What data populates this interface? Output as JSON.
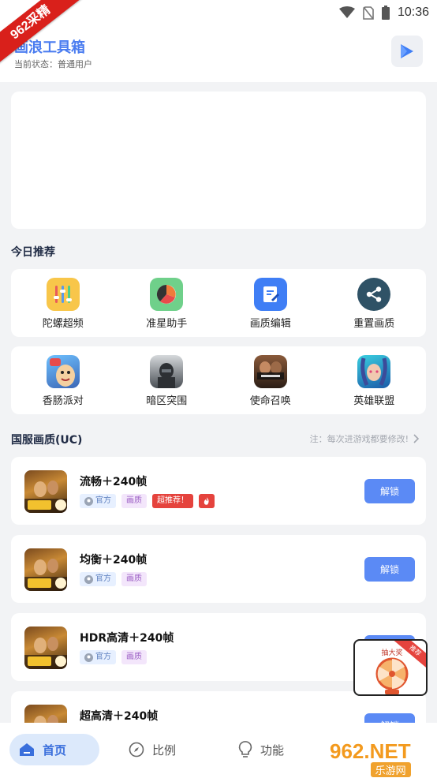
{
  "status_bar": {
    "time": "10:36",
    "icons": [
      "wifi-icon",
      "no-sim-icon",
      "battery-icon"
    ]
  },
  "corner_ribbon": "962采精",
  "header": {
    "title": "画浪工具箱",
    "user_status": "当前状态：普通用户",
    "play_icon": "play-icon"
  },
  "today_section": {
    "title": "今日推荐",
    "row1": [
      {
        "label": "陀螺超频",
        "icon": "gyro-icon",
        "color": "#f8c64a"
      },
      {
        "label": "准星助手",
        "icon": "crosshair-pie-icon",
        "color": "#6fd08a"
      },
      {
        "label": "画质编辑",
        "icon": "edit-icon",
        "color": "#3f7ef5"
      },
      {
        "label": "重置画质",
        "icon": "share-icon",
        "color": "#2f5266"
      }
    ],
    "row2": [
      {
        "label": "香肠派对",
        "icon": "sausage-party-icon"
      },
      {
        "label": "暗区突围",
        "icon": "arena-breakout-icon"
      },
      {
        "label": "使命召唤",
        "icon": "call-of-duty-icon"
      },
      {
        "label": "英雄联盟",
        "icon": "league-of-legends-icon"
      }
    ]
  },
  "preset_section": {
    "title": "国服画质(UC)",
    "note": "注：每次进游戏都要修改!"
  },
  "presets": [
    {
      "name": "流畅＋240帧",
      "tags": [
        "官方",
        "画质",
        "超推荐！"
      ],
      "hot": true,
      "button": "解锁"
    },
    {
      "name": "均衡＋240帧",
      "tags": [
        "官方",
        "画质"
      ],
      "hot": false,
      "button": "解锁"
    },
    {
      "name": "HDR高清＋240帧",
      "tags": [
        "官方",
        "画质"
      ],
      "hot": false,
      "button": "解锁"
    },
    {
      "name": "超高清＋240帧",
      "tags": [],
      "hot": false,
      "button": "解锁"
    }
  ],
  "float_widget": {
    "title": "抽大奖",
    "badge": "推荐"
  },
  "bottom_nav": [
    {
      "label": "首页",
      "icon": "home-icon",
      "active": true
    },
    {
      "label": "比例",
      "icon": "compass-icon",
      "active": false
    },
    {
      "label": "功能",
      "icon": "lightbulb-icon",
      "active": false
    }
  ],
  "watermark": {
    "main": "962.NET",
    "sub": "乐游网"
  }
}
